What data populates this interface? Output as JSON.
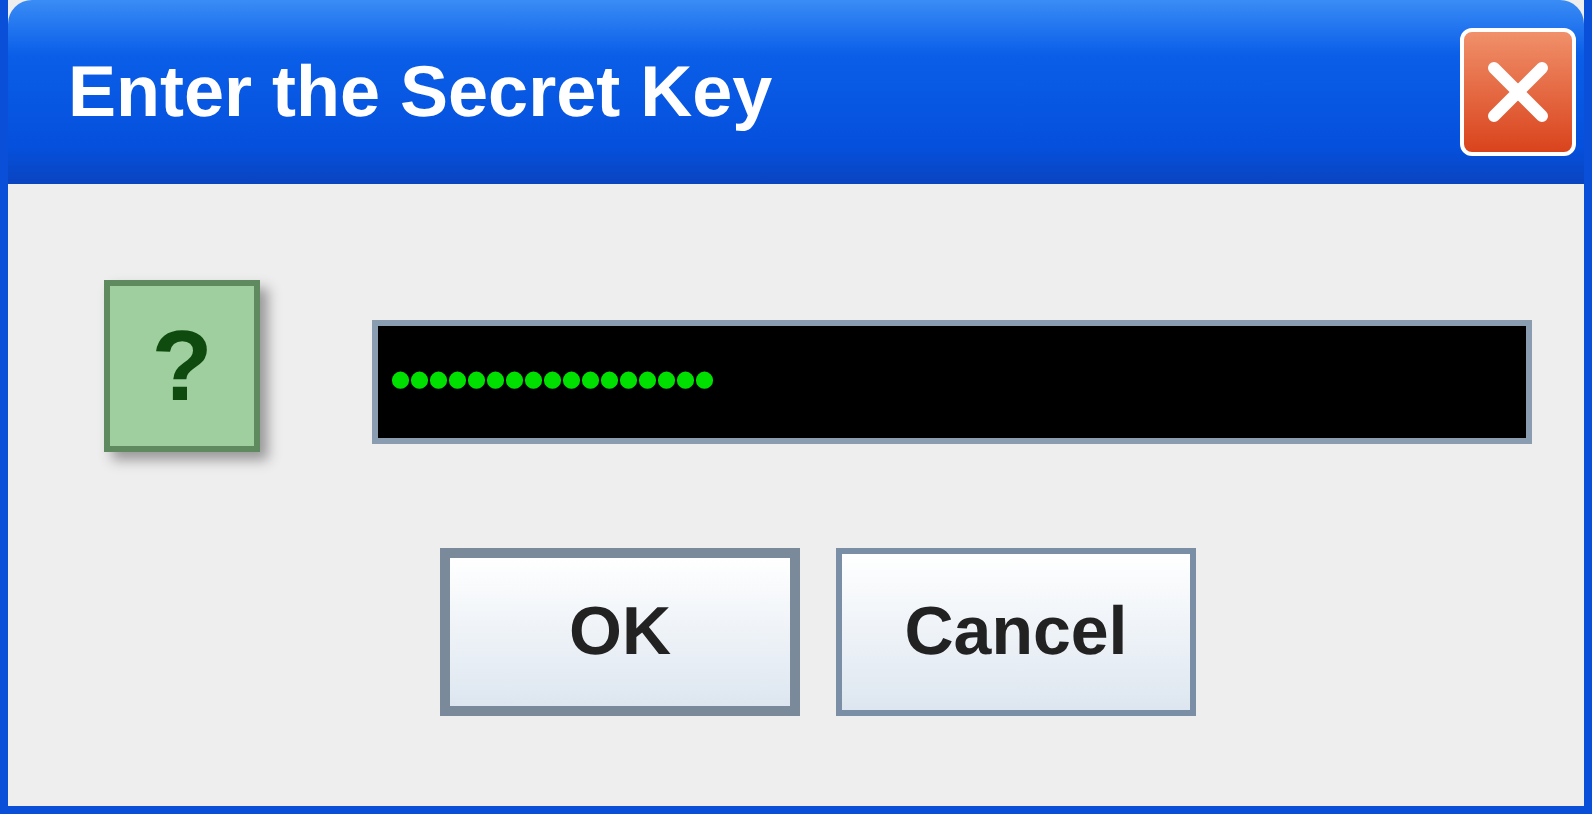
{
  "window": {
    "title": "Enter the Secret Key"
  },
  "question_icon": {
    "glyph": "?"
  },
  "password_field": {
    "value": "•••••••••••••••••"
  },
  "buttons": [
    {
      "label": "OK",
      "selected": true
    },
    {
      "label": "Cancel",
      "selected": false
    }
  ]
}
